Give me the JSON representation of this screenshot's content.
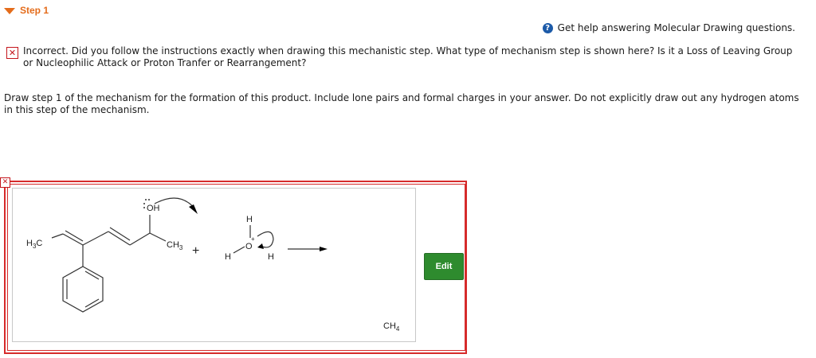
{
  "step": {
    "title": "Step 1"
  },
  "help": {
    "icon": "question-circle-icon",
    "label": "Get help answering Molecular Drawing questions."
  },
  "feedback": {
    "icon": "error-x-icon",
    "message": "Incorrect. Did you follow the instructions exactly when drawing this mechanistic step. What type of mechanism step is shown here? Is it a Loss of Leaving Group or Nucleophilic Attack or Proton Tranfer or Rearrangement?"
  },
  "instructions": "Draw step 1 of the mechanism for the formation of this product. Include lone pairs and formal charges in your answer. Do not explicitly draw out any hydrogen atoms in this step of the mechanism.",
  "drawing": {
    "h3c": "H",
    "h3c_sub": "3",
    "h3c_tail": "C",
    "oh": "OH",
    "ch3": "CH",
    "ch3_sub": "3",
    "plus": "+",
    "hydronium_o": "O",
    "charge_plus": "+",
    "h_top": "H",
    "h_left": "H",
    "h_right": "H",
    "product_c": "CH",
    "product_sub": "4"
  },
  "edit": {
    "label": "Edit"
  },
  "colors": {
    "step": "#e46c1b",
    "error": "#c4161c",
    "edit": "#2e8b2e",
    "help": "#1c5aa8"
  }
}
